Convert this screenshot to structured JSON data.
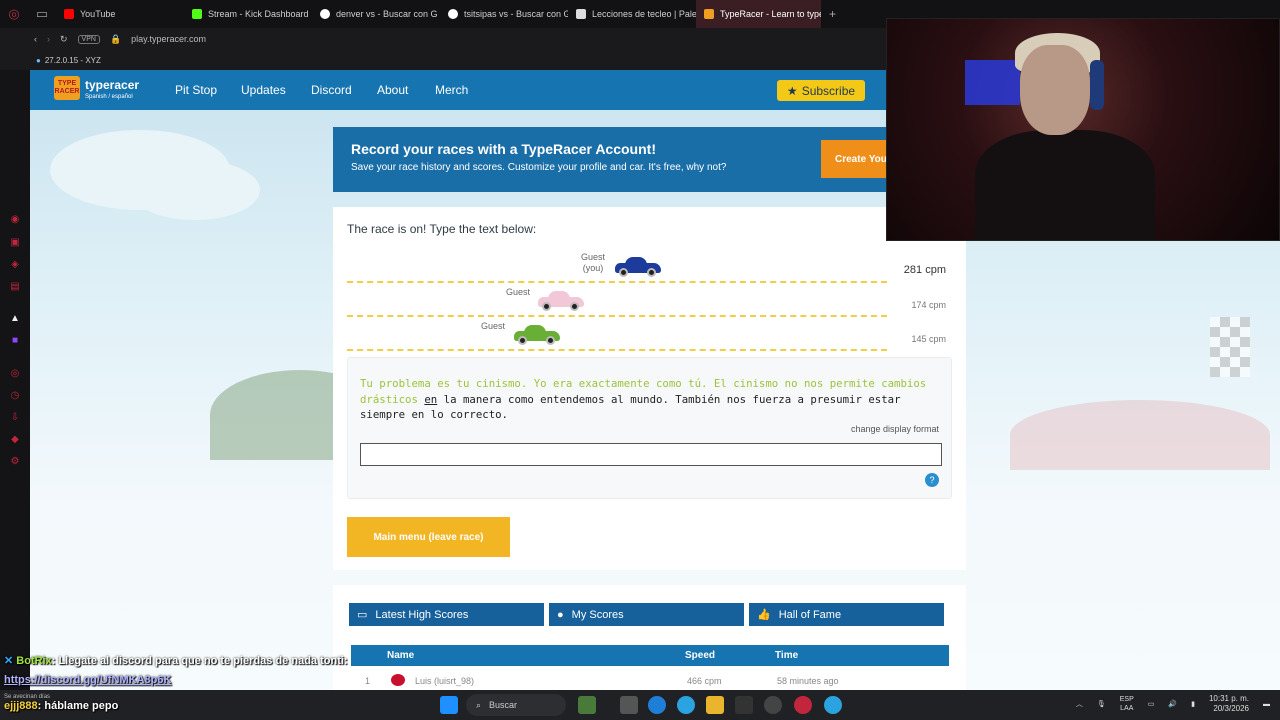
{
  "browser": {
    "tabs": [
      {
        "label": "YouTube",
        "color": "#ff0000"
      },
      {
        "label": "Stream - Kick Dashboard",
        "color": "#53fc18"
      },
      {
        "label": "denver vs - Buscar con G",
        "color": "#ffffff"
      },
      {
        "label": "tsitsipas vs - Buscar con G",
        "color": "#ffffff"
      },
      {
        "label": "Lecciones de tecleo | Pale",
        "color": "#ffffff"
      },
      {
        "label": "TypeRacer - Learn to type",
        "color": "#f0a020"
      }
    ],
    "vpn": "VPN",
    "url": "play.typeracer.com",
    "extension": "27.2.0.15 - XYZ"
  },
  "site": {
    "logo": {
      "badge": "TYPE RACER",
      "name": "typeracer",
      "sub": "Spanish / español"
    },
    "nav": [
      "Pit Stop",
      "Updates",
      "Discord",
      "About",
      "Merch"
    ],
    "subscribe": "Subscribe",
    "promo": {
      "title": "Record your races with a TypeRacer Account!",
      "subtitle": "Save your race history and scores. Customize your profile and car. It's free, why not?",
      "button": "Create You"
    }
  },
  "race": {
    "title": "The race is on! Type the text below:",
    "lanes": [
      {
        "name": "Guest",
        "you": "(you)",
        "cpm": "281 cpm",
        "color": "#1d3b9a",
        "progress": 0.45
      },
      {
        "name": "Guest",
        "you": "",
        "cpm": "174 cpm",
        "color": "#f2c8d8",
        "progress": 0.34
      },
      {
        "name": "Guest",
        "you": "",
        "cpm": "145 cpm",
        "color": "#6aaf35",
        "progress": 0.31
      }
    ],
    "passage_typed": "Tu problema es tu cinismo. Yo era exactamente como tú. El cinismo no nos permite cambios drásticos ",
    "passage_current": "en",
    "passage_rest": " la manera como entendemos al mundo. También nos fuerza a presumir estar siempre en lo correcto.",
    "change_format": "change display format",
    "main_menu": "Main menu (leave race)"
  },
  "scores": {
    "tabs": [
      "Latest High Scores",
      "My Scores",
      "Hall of Fame"
    ],
    "columns": [
      "Name",
      "Speed",
      "Time"
    ],
    "row": {
      "rank": "1",
      "name": "Luis (luisrt_98)",
      "speed": "466 cpm",
      "time": "58 minutes ago"
    }
  },
  "chat": {
    "line1_user": "BotRix",
    "line1_msg": ": Llegate al discord para que no te pierdas de",
    "line1_msg_bold": "nada tonti:",
    "line2_link": "https://discord.gg/UfNMKA8p6K",
    "line3_pre": "Se avecinan días",
    "line3_user": "ejjj888",
    "line3_msg": ": háblame pepo"
  },
  "taskbar": {
    "search": "Buscar",
    "lang_top": "ESP",
    "lang_bottom": "LAA",
    "time": "10:31 p. m.",
    "date": "20/3/2026"
  }
}
